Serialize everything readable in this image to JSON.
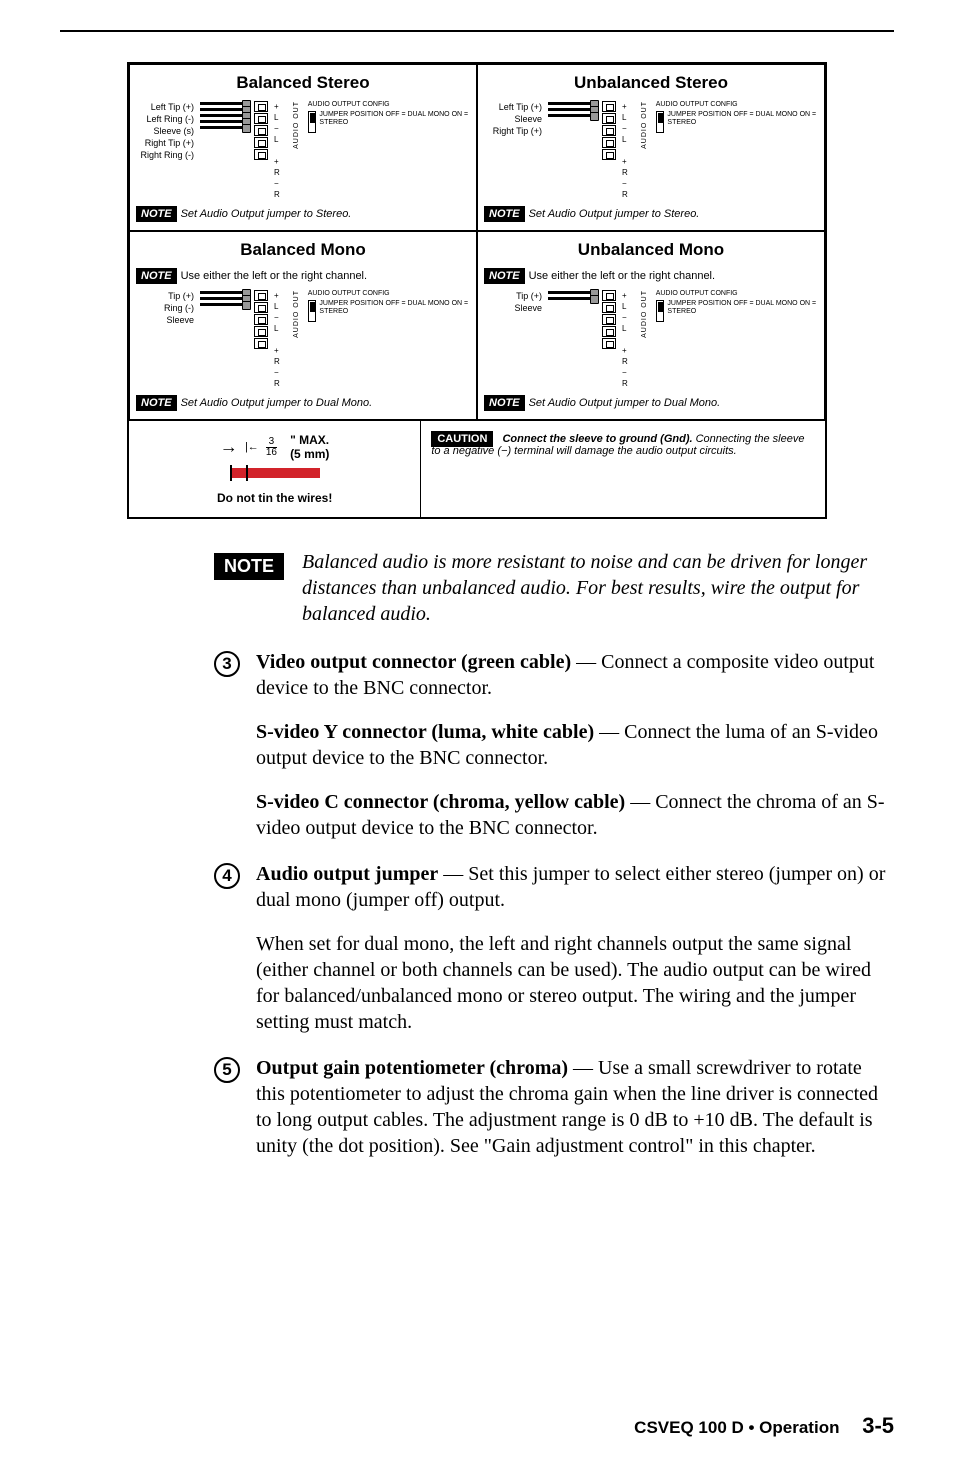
{
  "diagram": {
    "balanced_stereo": {
      "title": "Balanced Stereo",
      "wires": [
        "Left Tip (+)",
        "Left Ring (-)",
        "Sleeve (s)",
        "Right Tip (+)",
        "Right Ring (-)"
      ],
      "pins": [
        "L",
        "L",
        "",
        "R",
        "R"
      ],
      "signs": [
        "+",
        "−",
        "",
        "+",
        "−"
      ],
      "audio_out": "AUDIO OUT",
      "config": "AUDIO OUTPUT CONFIG",
      "jumper": "JUMPER POSITION OFF = DUAL MONO ON = STEREO",
      "note": "Set Audio Output jumper to Stereo."
    },
    "unbalanced_stereo": {
      "title": "Unbalanced Stereo",
      "wires": [
        "Left Tip (+)",
        "Sleeve",
        "Right Tip (+)"
      ],
      "pins": [
        "L",
        "L",
        "",
        "R",
        "R"
      ],
      "signs": [
        "+",
        "−",
        "",
        "+",
        "−"
      ],
      "audio_out": "AUDIO OUT",
      "config": "AUDIO OUTPUT CONFIG",
      "jumper": "JUMPER POSITION OFF = DUAL MONO ON = STEREO",
      "note": "Set Audio Output jumper to Stereo."
    },
    "balanced_mono": {
      "title": "Balanced Mono",
      "either_note": "Use either the left or the right channel.",
      "wires": [
        "Tip (+)",
        "Ring (-)",
        "Sleeve"
      ],
      "pins": [
        "L",
        "L",
        "",
        "R",
        "R"
      ],
      "signs": [
        "+",
        "−",
        "",
        "+",
        "−"
      ],
      "audio_out": "AUDIO OUT",
      "config": "AUDIO OUTPUT CONFIG",
      "jumper": "JUMPER POSITION OFF = DUAL MONO ON = STEREO",
      "note": "Set Audio Output jumper to Dual Mono."
    },
    "unbalanced_mono": {
      "title": "Unbalanced Mono",
      "either_note": "Use either the left or the right channel.",
      "wires": [
        "Tip (+)",
        "Sleeve"
      ],
      "pins": [
        "L",
        "L",
        "",
        "R",
        "R"
      ],
      "signs": [
        "+",
        "−",
        "",
        "+",
        "−"
      ],
      "audio_out": "AUDIO OUT",
      "config": "AUDIO OUTPUT CONFIG",
      "jumper": "JUMPER POSITION OFF = DUAL MONO ON = STEREO",
      "note": "Set Audio Output jumper to Dual Mono."
    },
    "bottom": {
      "frac_num": "3",
      "frac_den": "16",
      "max": "\" MAX.",
      "mm": "(5 mm)",
      "tin": "Do not tin the wires!",
      "caution": "CAUTION",
      "caution_bold": "Connect the sleeve to ground (Gnd).",
      "caution_rest": "  Connecting the sleeve to a negative (−) terminal will damage the audio output circuits."
    },
    "note_label": "NOTE"
  },
  "main_note": {
    "label": "NOTE",
    "text": "Balanced audio is more resistant to noise and can be driven for longer distances than unbalanced audio.  For best results, wire the output for balanced audio."
  },
  "items": {
    "3": {
      "p1_bold": "Video output connector (green cable)",
      "p1_rest": " — Connect a composite video output device to the BNC connector.",
      "p2_bold": "S-video Y connector (luma, white cable)",
      "p2_rest": " — Connect the luma of an S-video output device to the BNC connector.",
      "p3_bold": "S-video C connector (chroma, yellow cable)",
      "p3_rest": " — Connect the chroma of an S-video output device to the BNC connector."
    },
    "4": {
      "p1_bold": "Audio output jumper",
      "p1_rest": " — Set this jumper to select either stereo (jumper on) or dual mono (jumper off) output.",
      "p2": "When set for dual mono, the left and right channels output the same signal (either channel or both channels can be used).  The audio output can be wired for balanced/unbalanced mono or stereo output.  The wiring and the jumper setting must match."
    },
    "5": {
      "p1_bold": "Output gain potentiometer (chroma)",
      "p1_rest": " — Use a small screwdriver to rotate this potentiometer to adjust the chroma gain when the line driver is connected to long output cables.  The adjustment range is 0 dB to +10 dB.  The default is unity (the dot position).  See \"Gain adjustment control\" in this chapter."
    }
  },
  "footer": {
    "title": "CSVEQ 100 D • Operation",
    "page": "3-5"
  }
}
